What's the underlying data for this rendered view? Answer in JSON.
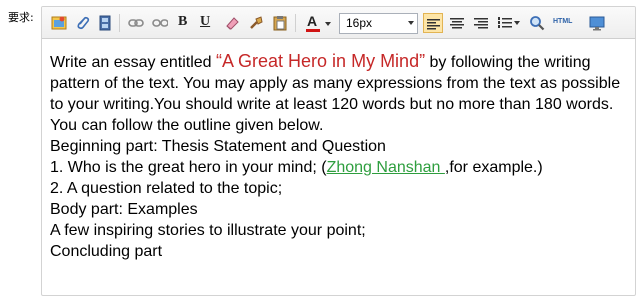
{
  "label": "要求:",
  "toolbar": {
    "font_size": "16px",
    "html_label": "HTML",
    "bold": "B",
    "underline": "U",
    "font_color_letter": "A"
  },
  "content": {
    "line1_pre": "Write an essay entitled ",
    "title": "“A Great Hero in My Mind”",
    "line1_post": " by following the writing pattern of the text. You may apply as many expressions from the text as possible to your writing.You should write at least 120 words but no more than 180 words.",
    "line2": "You can follow the outline given below.",
    "line3": "Beginning part: Thesis Statement and Question",
    "line4_pre": "1. Who is the great hero in your mind; (",
    "line4_link": "Zhong Nanshan ",
    "line4_post": ",for example.)",
    "line5": "2. A question related to the topic;",
    "line6": "Body part: Examples",
    "line7": "A few inspiring stories to illustrate your point;",
    "line8": "Concluding part"
  },
  "colors": {
    "title": "#c62828",
    "link": "#2e9e3e",
    "active_button": "#fde5a7",
    "font_color_bar": "#d01414"
  }
}
